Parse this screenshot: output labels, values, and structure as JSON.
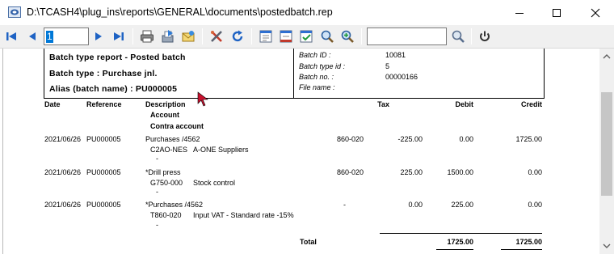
{
  "window": {
    "title": "D:\\TCASH4\\plug_ins\\reports\\GENERAL\\documents\\postedbatch.rep"
  },
  "toolbar": {
    "page_value": "1",
    "search_value": ""
  },
  "report": {
    "header": {
      "line1": "Batch type report - Posted batch",
      "line2": "Batch type  :  Purchase jnl.",
      "line3": "Alias (batch name)  :  PU000005",
      "fields": [
        {
          "label": "Batch ID  :",
          "value": "10081"
        },
        {
          "label": "Batch type id  :",
          "value": "5"
        },
        {
          "label": "Batch no.  :",
          "value": "00000166"
        },
        {
          "label": "File name  :",
          "value": ""
        }
      ]
    },
    "columns": {
      "date": "Date",
      "reference": "Reference",
      "description": "Description",
      "account": "Account",
      "contra": "Contra account",
      "tax": "Tax",
      "debit": "Debit",
      "credit": "Credit"
    },
    "rows": [
      {
        "date": "2021/06/26",
        "ref": "PU000005",
        "desc": "Purchases /4562",
        "acct_code": "C2AO-NES",
        "acct_name": "A-ONE Suppliers",
        "contra": "-",
        "tax_code": "860-020",
        "tax": "-225.00",
        "debit": "0.00",
        "credit": "1725.00"
      },
      {
        "date": "2021/06/26",
        "ref": "PU000005",
        "desc": "*Drill press",
        "acct_code": "G750-000",
        "acct_name": "Stock control",
        "contra": "-",
        "tax_code": "860-020",
        "tax": "225.00",
        "debit": "1500.00",
        "credit": "0.00"
      },
      {
        "date": "2021/06/26",
        "ref": "PU000005",
        "desc": "*Purchases /4562",
        "acct_code": "T860-020",
        "acct_name": "Input VAT - Standard rate -15%",
        "contra": "-",
        "tax_code": "-",
        "tax": "0.00",
        "debit": "225.00",
        "credit": "0.00"
      }
    ],
    "total": {
      "label": "Total",
      "debit": "1725.00",
      "credit": "1725.00"
    }
  }
}
